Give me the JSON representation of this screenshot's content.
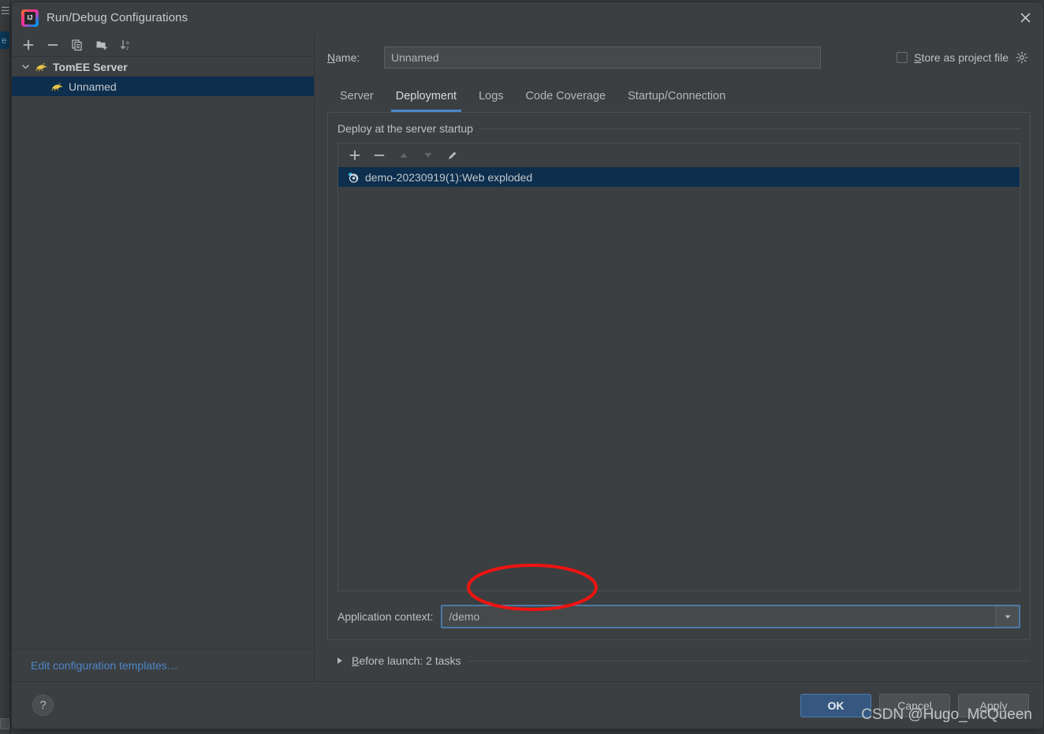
{
  "window": {
    "title": "Run/Debug Configurations",
    "app_icon": "intellij-idea-icon",
    "close_icon": "close-icon"
  },
  "left_pane": {
    "toolbar": [
      {
        "name": "add-configuration-button",
        "icon": "plus-icon",
        "label": "+"
      },
      {
        "name": "remove-configuration-button",
        "icon": "minus-icon",
        "label": "−"
      },
      {
        "name": "copy-configuration-button",
        "icon": "copy-icon",
        "label": "Copy"
      },
      {
        "name": "new-folder-button",
        "icon": "folder-add-icon",
        "label": "New Folder"
      },
      {
        "name": "sort-configurations-button",
        "icon": "sort-alphabetical-icon",
        "label": "Sort"
      }
    ],
    "tree": [
      {
        "label": "TomEE Server",
        "icon": "tomee-icon",
        "expanded": true,
        "selected": false,
        "level": 0
      },
      {
        "label": "Unnamed",
        "icon": "tomee-icon",
        "expanded": false,
        "selected": true,
        "level": 1
      }
    ],
    "footer_link": "Edit configuration templates…"
  },
  "form": {
    "name_label": "Name:",
    "name_mnemonic": "N",
    "name_value": "Unnamed",
    "name_placeholder": "Unnamed",
    "store_as_project_file_label": "Store as project file",
    "store_as_project_file_mnemonic": "S",
    "store_as_project_file_checked": false,
    "settings_gear_icon": "gear-icon"
  },
  "tabs": [
    {
      "label": "Server",
      "active": false
    },
    {
      "label": "Deployment",
      "active": true
    },
    {
      "label": "Logs",
      "active": false
    },
    {
      "label": "Code Coverage",
      "active": false
    },
    {
      "label": "Startup/Connection",
      "active": false
    }
  ],
  "deployment": {
    "group_title": "Deploy at the server startup",
    "toolbar": [
      {
        "name": "add-artifact-button",
        "icon": "plus-icon",
        "enabled": true
      },
      {
        "name": "remove-artifact-button",
        "icon": "minus-icon",
        "enabled": true
      },
      {
        "name": "move-artifact-up-button",
        "icon": "arrow-up-icon",
        "enabled": false
      },
      {
        "name": "move-artifact-down-button",
        "icon": "arrow-down-icon",
        "enabled": false
      },
      {
        "name": "edit-artifact-button",
        "icon": "pencil-icon",
        "enabled": true
      }
    ],
    "items": [
      {
        "label": "demo-20230919(1):Web exploded",
        "icon": "artifact-icon",
        "selected": true
      }
    ],
    "application_context_label": "Application context:",
    "application_context_value": "/demo",
    "application_context_dropdown_icon": "chevron-down-icon"
  },
  "before_launch": {
    "expander_icon": "triangle-right-icon",
    "label": "Before launch: 2 tasks",
    "mnemonic": "B"
  },
  "footer": {
    "help_label": "?",
    "ok_label": "OK",
    "cancel_label": "Cancel",
    "apply_label": "Apply",
    "apply_mnemonic": "A"
  },
  "watermark": "CSDN @Hugo_McQueen",
  "annotation": {
    "type": "ellipse",
    "color": "#ee1411",
    "stroke_width": 4,
    "targets": "application-context-field"
  },
  "colors": {
    "dialog_background": "#3c3f41",
    "selection_blue": "#0d2e4d",
    "accent_blue": "#4a88c7",
    "link_blue": "#4d86c9",
    "primary_button": "#365880",
    "annotation_red": "#ee1411"
  }
}
